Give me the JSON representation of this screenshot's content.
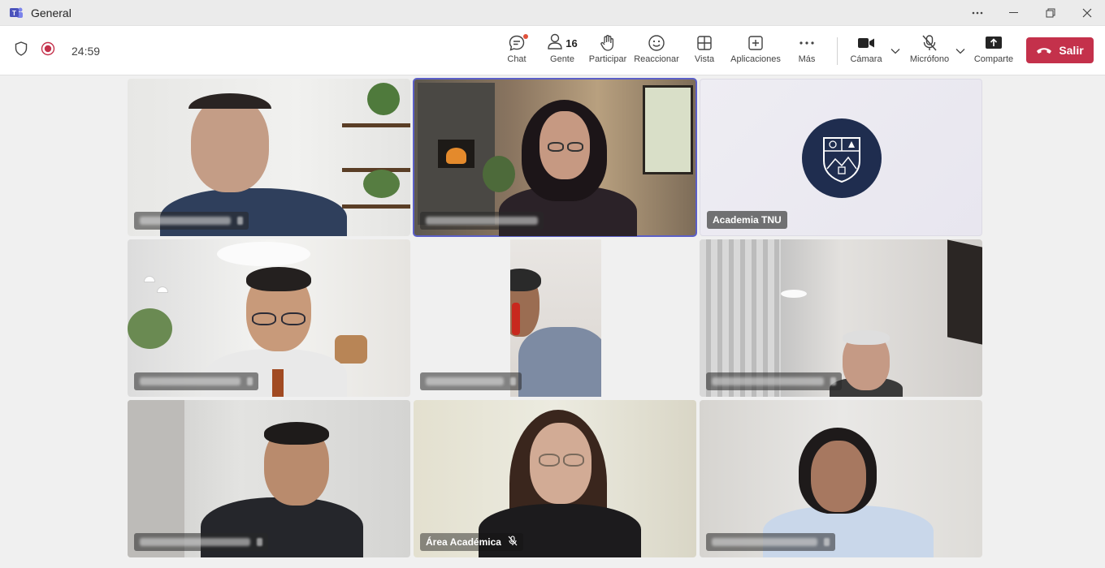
{
  "window": {
    "title": "General"
  },
  "meeting": {
    "timer": "24:59",
    "people_count": "16"
  },
  "toolbar": {
    "chat": "Chat",
    "people": "Gente",
    "raise": "Participar",
    "react": "Reaccionar",
    "view": "Vista",
    "apps": "Aplicaciones",
    "more": "Más",
    "camera": "Cámara",
    "mic": "Micrófono",
    "share": "Comparte",
    "leave": "Salir"
  },
  "tiles": {
    "academia": {
      "name": "Academia TNU"
    },
    "area": {
      "name": "Área Académica"
    }
  },
  "colors": {
    "accent": "#5b5fc7",
    "leave": "#c4314b",
    "logo_bg": "#1f2d4f"
  }
}
